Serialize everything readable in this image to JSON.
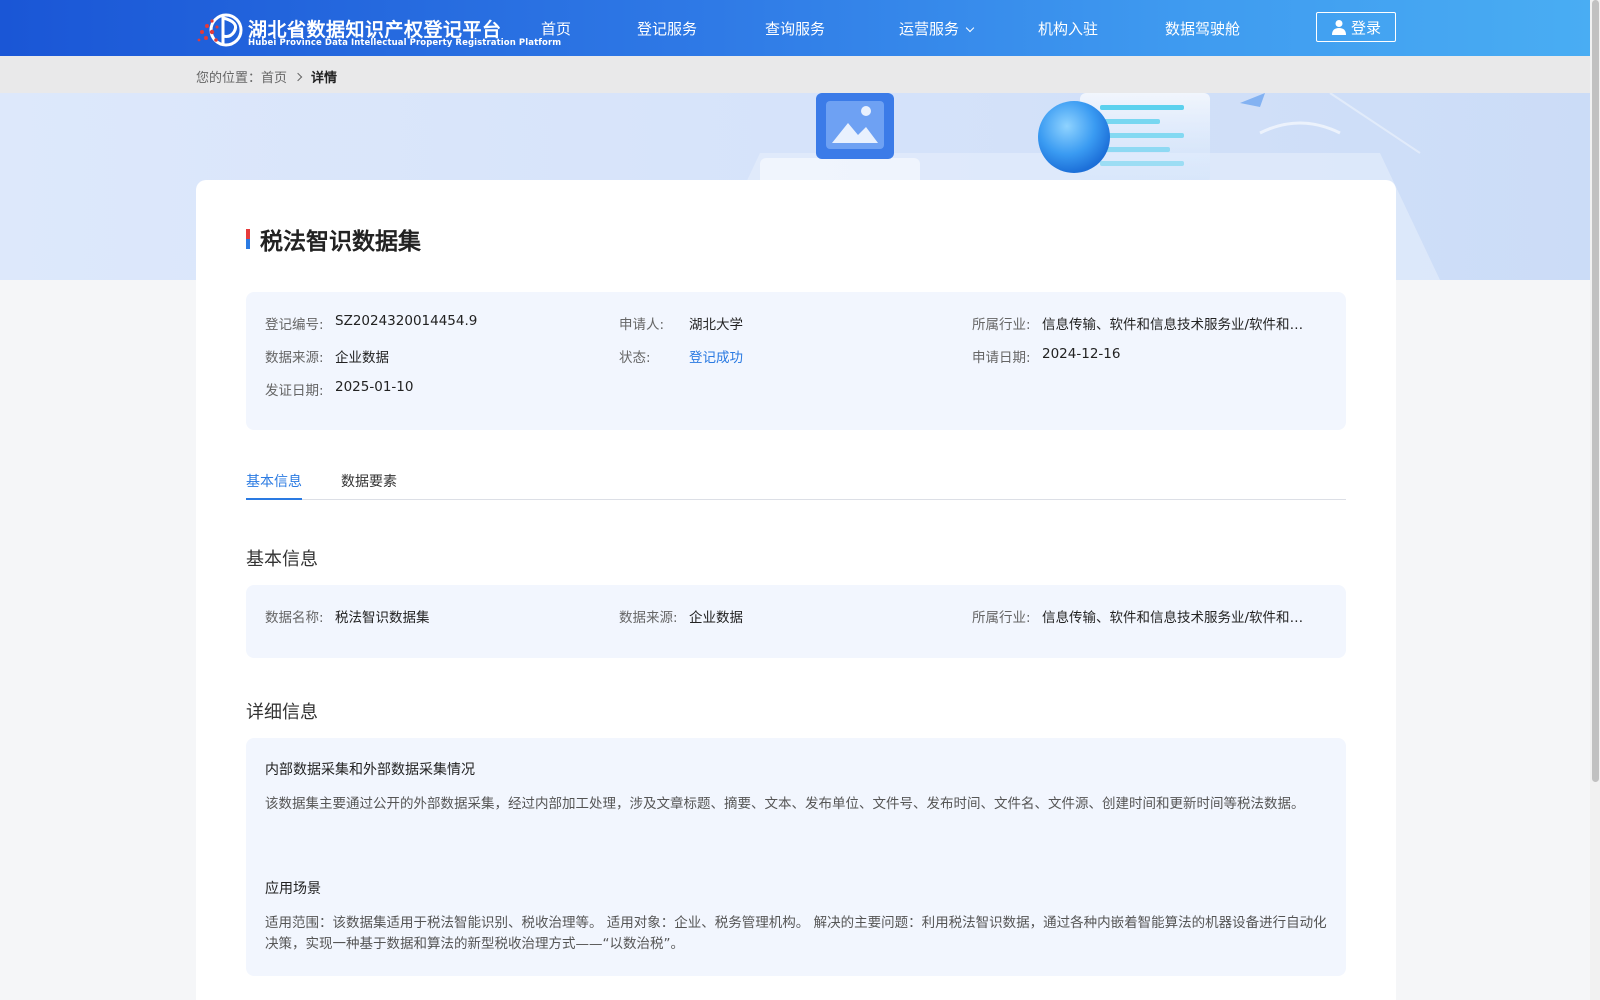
{
  "header": {
    "brand_cn": "湖北省数据知识产权登记平台",
    "brand_en": "Hubei Province Data Intellectual Property Registration Platform",
    "nav": [
      {
        "label": "首页"
      },
      {
        "label": "登记服务"
      },
      {
        "label": "查询服务"
      },
      {
        "label": "运营服务",
        "has_dropdown": true
      },
      {
        "label": "机构入驻"
      },
      {
        "label": "数据驾驶舱"
      }
    ],
    "login_label": "登录",
    "colors": {
      "gradient_start": "#1a56d6",
      "gradient_end": "#49adf3"
    }
  },
  "breadcrumb": {
    "prefix": "您的位置：",
    "home": "首页",
    "current": "详情"
  },
  "detail": {
    "title": "税法智识数据集",
    "meta": {
      "reg_no_label": "登记编号:",
      "reg_no": "SZ2024320014454.9",
      "applicant_label": "申请人:",
      "applicant": "湖北大学",
      "industry_label": "所属行业:",
      "industry": "信息传输、软件和信息技术服务业/软件和信息技术服务业",
      "source_label": "数据来源:",
      "source": "企业数据",
      "status_label": "状态:",
      "status": "登记成功",
      "apply_date_label": "申请日期:",
      "apply_date": "2024-12-16",
      "cert_date_label": "发证日期:",
      "cert_date": "2025-01-10"
    },
    "tabs": [
      {
        "label": "基本信息",
        "active": true
      },
      {
        "label": "数据要素",
        "active": false
      }
    ],
    "basic": {
      "section_title": "基本信息",
      "name_label": "数据名称:",
      "name": "税法智识数据集",
      "source_label": "数据来源:",
      "source": "企业数据",
      "industry_label": "所属行业:",
      "industry": "信息传输、软件和信息技术服务业/软件和信息技术服务业"
    },
    "details": {
      "section_title": "详细信息",
      "collection_title": "内部数据采集和外部数据采集情况",
      "collection_text": "该数据集主要通过公开的外部数据采集，经过内部加工处理，涉及文章标题、摘要、文本、发布单位、文件号、发布时间、文件名、文件源、创建时间和更新时间等税法数据。",
      "scenario_title": "应用场景",
      "scenario_text": "适用范围：该数据集适用于税法智能识别、税收治理等。 适用对象：企业、税务管理机构。 解决的主要问题：利用税法智识数据，通过各种内嵌着智能算法的机器设备进行自动化决策，实现一种基于数据和算法的新型税收治理方式——“以数治税”。"
    },
    "colors": {
      "accent": "#2a7ae2",
      "panel": "#f2f6fe"
    }
  }
}
